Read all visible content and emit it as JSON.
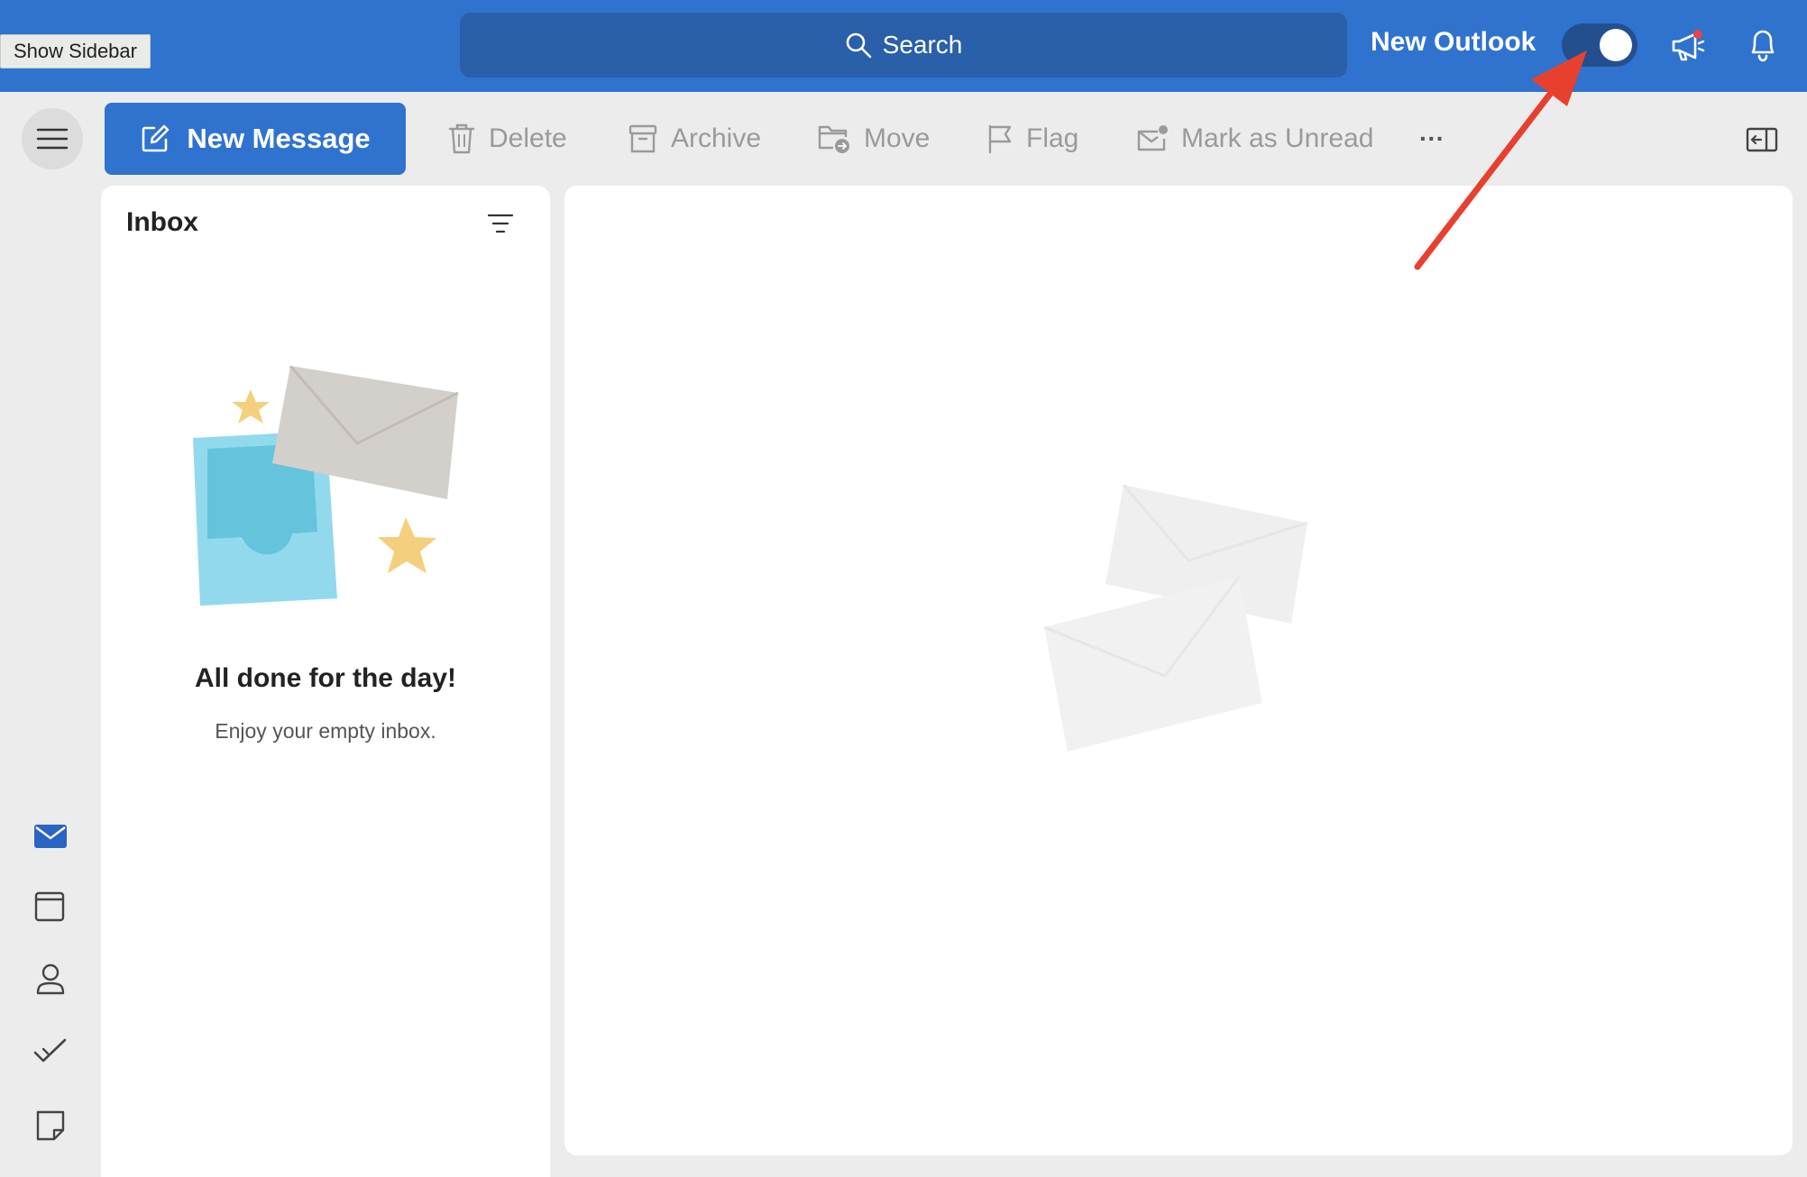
{
  "titlebar": {
    "search_label": "Search",
    "new_outlook_label": "New Outlook",
    "new_outlook_enabled": true,
    "accent_color": "#2f73cf"
  },
  "tooltip": {
    "text": "Show Sidebar"
  },
  "toolbar": {
    "new_message_label": "New Message",
    "delete_label": "Delete",
    "archive_label": "Archive",
    "move_label": "Move",
    "flag_label": "Flag",
    "mark_unread_label": "Mark as Unread",
    "more_label": "···"
  },
  "inbox": {
    "title": "Inbox",
    "empty_title": "All done for the day!",
    "empty_subtitle": "Enjoy your empty inbox."
  },
  "nav": {
    "items": [
      "mail-icon",
      "calendar-icon",
      "people-icon",
      "todo-icon",
      "notes-icon"
    ],
    "active": "mail-icon"
  }
}
